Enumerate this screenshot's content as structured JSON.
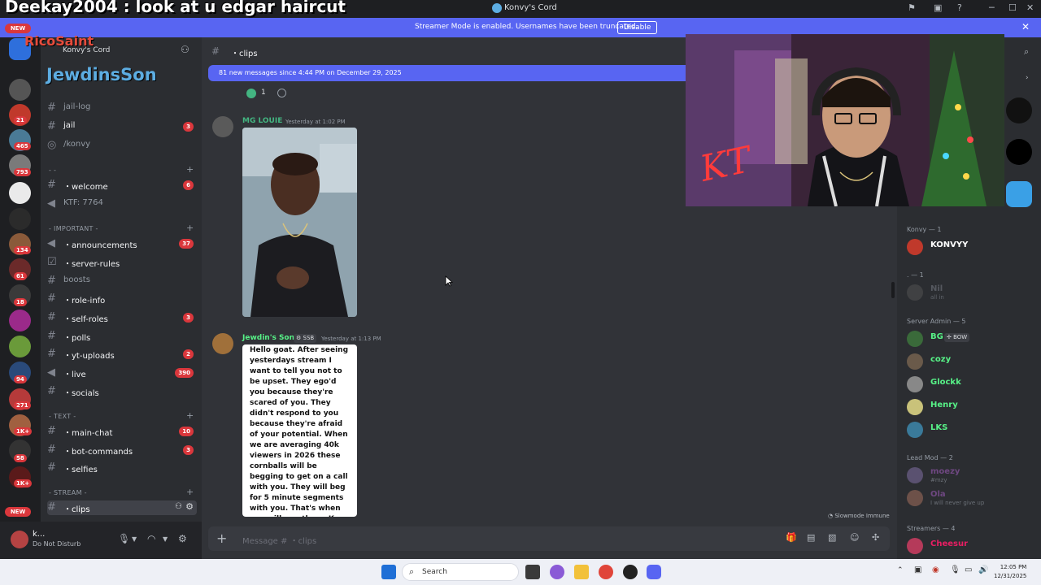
{
  "window": {
    "title": "Konvy's Cord",
    "controls": [
      "minimize",
      "maximize",
      "close"
    ]
  },
  "overlay_chat": "Deekay2004 : look at u edgar haircut",
  "streamer_banner": {
    "text": "Streamer Mode is enabled. Usernames have been truncated.",
    "button": "Disable"
  },
  "rail": {
    "new_top": "NEW",
    "new_bottom": "NEW",
    "badges": [
      "21",
      "465",
      "793",
      "134",
      "61",
      "18",
      "94",
      "271",
      "1K+",
      "58",
      "1K+"
    ]
  },
  "overlay_names": {
    "name1": "RicoSaint",
    "name2": "JewdinsSon"
  },
  "server": {
    "name": "Konvy's Cord"
  },
  "channels": [
    {
      "name": "jail-log",
      "badge": ""
    },
    {
      "name": "jail",
      "badge": "3"
    },
    {
      "name": "/konvy",
      "badge": ""
    },
    {
      "name": "・welcome",
      "badge": "6"
    },
    {
      "name": "KTF: 7764",
      "badge": ""
    },
    {
      "name": "・announcements",
      "badge": "37"
    },
    {
      "name": "・server-rules",
      "badge": ""
    },
    {
      "name": "boosts",
      "badge": ""
    },
    {
      "name": "・role-info",
      "badge": ""
    },
    {
      "name": "・self-roles",
      "badge": "3"
    },
    {
      "name": "・polls",
      "badge": ""
    },
    {
      "name": "・yt-uploads",
      "badge": "2"
    },
    {
      "name": "・live",
      "badge": "390"
    },
    {
      "name": "・socials",
      "badge": ""
    },
    {
      "name": "・main-chat",
      "badge": "10"
    },
    {
      "name": "・bot-commands",
      "badge": "3"
    },
    {
      "name": "・selfies",
      "badge": ""
    },
    {
      "name": "・clips",
      "badge": ""
    }
  ],
  "categories": {
    "c1": "- -",
    "c2": "- IMPORTANT -",
    "c3": "- TEXT -",
    "c4": "- STREAM -"
  },
  "user_panel": {
    "name": "k...",
    "status": "Do Not Disturb"
  },
  "chat": {
    "channel": "・clips",
    "new_messages": "81 new messages since 4:44 PM on December 29, 2025",
    "reaction_count": "1",
    "messages": [
      {
        "author": "MG LOUIE",
        "time": "Yesterday at 1:02 PM"
      },
      {
        "author": "Jewdin's Son",
        "tag": "SSB",
        "time": "Yesterday at 1:13 PM",
        "image_text": "Hello goat. After seeing yesterdays stream I want to tell you not to be upset. They ego'd you because they're scared of you. They didn't respond to you because they're afraid of your potential. When we are averaging 40k viewers in 2026 these cornballs will be begging to get on a call with you. They will beg for 5 minute segments with you. That's when you will ego them. Keep your head up goat. KON"
      }
    ],
    "slowmode": "Slowmode Immune",
    "composer_placeholder": "Message # ・clips"
  },
  "members": {
    "groups": [
      {
        "label": "Konvy — 1",
        "members": [
          {
            "name": "KONVYY",
            "status": "",
            "color": "#ffffff"
          }
        ]
      },
      {
        "label": ". — 1",
        "members": [
          {
            "name": "Nil",
            "status": "all in",
            "color": "#80848e"
          }
        ]
      },
      {
        "label": "Server Admin — 5",
        "members": [
          {
            "name": "BG",
            "status": "",
            "tag": "BOW",
            "color": "#57f287"
          },
          {
            "name": "cozy",
            "status": "",
            "color": "#57f287"
          },
          {
            "name": "Glockk",
            "status": "",
            "color": "#57f287"
          },
          {
            "name": "Henry",
            "status": "",
            "color": "#57f287"
          },
          {
            "name": "LKS",
            "status": "",
            "color": "#57f287"
          }
        ]
      },
      {
        "label": "Lead Mod — 2",
        "members": [
          {
            "name": "moezy",
            "status": "#mzy",
            "color": "#9b59b6"
          },
          {
            "name": "Ola",
            "status": "I will never give up",
            "color": "#9b59b6"
          }
        ]
      },
      {
        "label": "Streamers — 4",
        "members": [
          {
            "name": "Cheesur",
            "status": "",
            "color": "#e91e63"
          }
        ]
      }
    ]
  },
  "taskbar": {
    "search": "Search",
    "time": "12:05 PM",
    "date": "12/31/2025"
  },
  "cam_overlay_text": "KT",
  "colors": {
    "blurple": "#5865f2",
    "danger": "#da373c",
    "admin_green": "#57f287",
    "mg_louie": "#43b581"
  }
}
